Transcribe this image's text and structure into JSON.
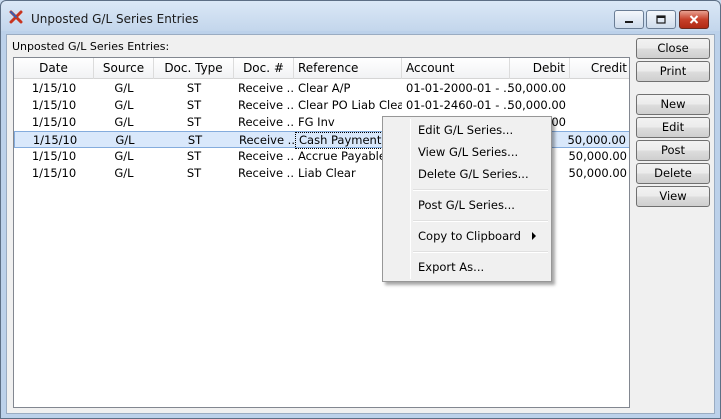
{
  "window": {
    "title": "Unposted G/L Series Entries"
  },
  "list": {
    "label": "Unposted G/L Series Entries:",
    "columns": [
      "Date",
      "Source",
      "Doc. Type",
      "Doc. #",
      "Reference",
      "Account",
      "Debit",
      "Credit"
    ],
    "rows": [
      {
        "date": "1/15/10",
        "source": "G/L",
        "doc_type": "ST",
        "doc_no": "Receive ...",
        "reference": "Clear A/P",
        "account": "01-01-2000-01 - ...",
        "debit": "50,000.00",
        "credit": ""
      },
      {
        "date": "1/15/10",
        "source": "G/L",
        "doc_type": "ST",
        "doc_no": "Receive ...",
        "reference": "Clear PO Liab Clear",
        "account": "01-01-2460-01 - ...",
        "debit": "50,000.00",
        "credit": ""
      },
      {
        "date": "1/15/10",
        "source": "G/L",
        "doc_type": "ST",
        "doc_no": "Receive ...",
        "reference": "FG Inv",
        "account": "",
        "debit": "00",
        "credit": ""
      },
      {
        "date": "1/15/10",
        "source": "G/L",
        "doc_type": "ST",
        "doc_no": "Receive ...",
        "reference": "Cash Payment",
        "account": "",
        "debit": "",
        "credit": "50,000.00"
      },
      {
        "date": "1/15/10",
        "source": "G/L",
        "doc_type": "ST",
        "doc_no": "Receive ...",
        "reference": "Accrue Payable",
        "account": "",
        "debit": "",
        "credit": "50,000.00"
      },
      {
        "date": "1/15/10",
        "source": "G/L",
        "doc_type": "ST",
        "doc_no": "Receive ...",
        "reference": "Liab Clear",
        "account": "",
        "debit": "",
        "credit": "50,000.00"
      }
    ],
    "selected_row": 3
  },
  "buttons": {
    "close": "Close",
    "print": "Print",
    "new": "New",
    "edit": "Edit",
    "post": "Post",
    "delete": "Delete",
    "view": "View"
  },
  "context_menu": {
    "edit": "Edit G/L Series...",
    "view": "View G/L Series...",
    "delete": "Delete G/L Series...",
    "post": "Post G/L Series...",
    "copy": "Copy to Clipboard",
    "export": "Export As..."
  },
  "colors": {
    "selection": "#d9e8fb",
    "selection_border": "#84acdd",
    "app_icon": "#d0392b"
  }
}
